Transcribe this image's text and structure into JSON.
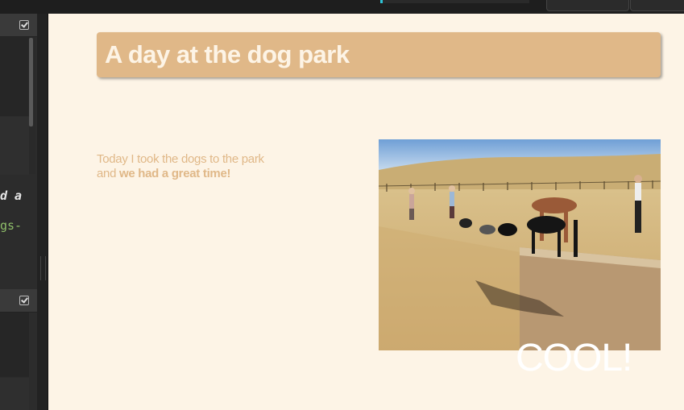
{
  "editor": {
    "code_line_1": "d a",
    "code_line_2": "gs-"
  },
  "page": {
    "title": "A day at the dog park",
    "body_lead": "Today I took the dogs to the park and ",
    "body_bold": "we had a great time!",
    "caption": "COOL!"
  },
  "colors": {
    "page_background": "#fdf4e6",
    "title_background": "#e0b888",
    "text_accent": "#e0b888",
    "editor_background": "#2c2c2c"
  },
  "icons": [
    "checkbox-icon",
    "checkbox-icon"
  ]
}
